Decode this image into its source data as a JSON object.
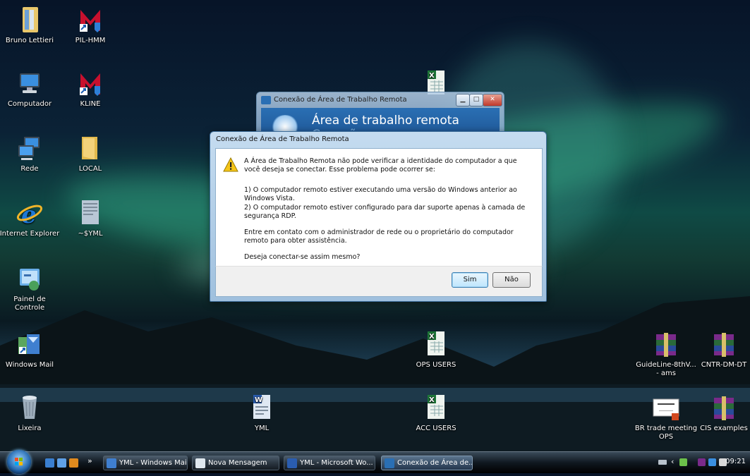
{
  "desktop": {
    "icons": [
      {
        "label": "Bruno Lettieri",
        "icon": "user-folder-icon"
      },
      {
        "label": "PIL-HMM",
        "icon": "mcafee-shortcut-icon"
      },
      {
        "label": "Computador",
        "icon": "computer-icon"
      },
      {
        "label": "KLINE",
        "icon": "mcafee-shortcut-icon"
      },
      {
        "label": "Rede",
        "icon": "network-icon"
      },
      {
        "label": "LOCAL",
        "icon": "folder-icon"
      },
      {
        "label": "Internet Explorer",
        "icon": "internet-explorer-icon"
      },
      {
        "label": "~$YML",
        "icon": "document-icon"
      },
      {
        "label": "Painel de Controle",
        "icon": "control-panel-icon"
      },
      {
        "label": "Windows Mail",
        "icon": "windows-mail-icon"
      },
      {
        "label": "Lixeira",
        "icon": "recycle-bin-icon"
      },
      {
        "label": "YML",
        "icon": "word-document-icon"
      },
      {
        "label": "OPS USERS",
        "icon": "excel-file-icon"
      },
      {
        "label": "ACC USERS",
        "icon": "excel-file-icon"
      },
      {
        "label": "GuideLine-8thV... - ams",
        "icon": "winrar-archive-icon"
      },
      {
        "label": "CNTR-DM-DT",
        "icon": "winrar-archive-icon"
      },
      {
        "label": "BR trade meeting OPS",
        "icon": "powerpoint-file-icon"
      },
      {
        "label": "CIS examples",
        "icon": "winrar-archive-icon"
      },
      {
        "label": "",
        "icon": "excel-file-icon"
      }
    ]
  },
  "background_window": {
    "title": "Conexão de Área de Trabalho Remota",
    "banner_line1": "Área de trabalho remota",
    "banner_line2": "Conexão"
  },
  "dialog": {
    "title": "Conexão de Área de Trabalho Remota",
    "p1": "A Área de Trabalho Remota não pode verificar a identidade do computador a que você deseja se conectar. Esse problema pode ocorrer se:",
    "p2": "1) O computador remoto estiver executando uma versão do Windows anterior ao Windows Vista.",
    "p3": "2) O computador remoto estiver configurado para dar suporte apenas à camada de segurança RDP.",
    "p4": "Entre em contato com o administrador de rede ou o proprietário do computador remoto para obter assistência.",
    "p5": "Deseja conectar-se assim mesmo?",
    "yes_label": "Sim",
    "no_label": "Não"
  },
  "taskbar": {
    "buttons": [
      {
        "label": "YML - Windows Mail",
        "icon": "windows-mail-icon"
      },
      {
        "label": "Nova Mensagem",
        "icon": "new-message-icon"
      },
      {
        "label": "YML - Microsoft Wo...",
        "icon": "word-icon"
      },
      {
        "label": "Conexão de Área de...",
        "icon": "remote-desktop-icon"
      }
    ],
    "overflow_label": "»",
    "clock": "09:21"
  },
  "colors": {
    "excel": "#1f7a3a",
    "winrar": "#7a2a8a",
    "mcafee": "#c8102e"
  }
}
